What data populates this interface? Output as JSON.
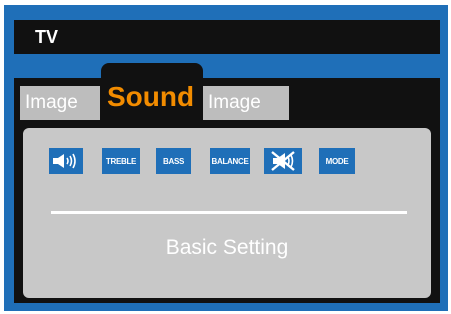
{
  "window": {
    "title": "TV"
  },
  "tabs": [
    {
      "label": "Image"
    },
    {
      "label": "Sound"
    },
    {
      "label": "Image"
    }
  ],
  "active_tab": "Sound",
  "toolbar": {
    "buttons": [
      {
        "icon": "volume-icon"
      },
      {
        "label": "TREBLE"
      },
      {
        "label": "BASS"
      },
      {
        "label": "BALANCE"
      },
      {
        "icon": "mute-icon"
      },
      {
        "label": "MODE"
      }
    ]
  },
  "section": {
    "title": "Basic Setting"
  },
  "colors": {
    "frame": "#1f6fb8",
    "bar": "#111111",
    "active_tab_text": "#f28c00",
    "inactive_tab": "#bdbdbd",
    "content": "#c8c8c8"
  }
}
